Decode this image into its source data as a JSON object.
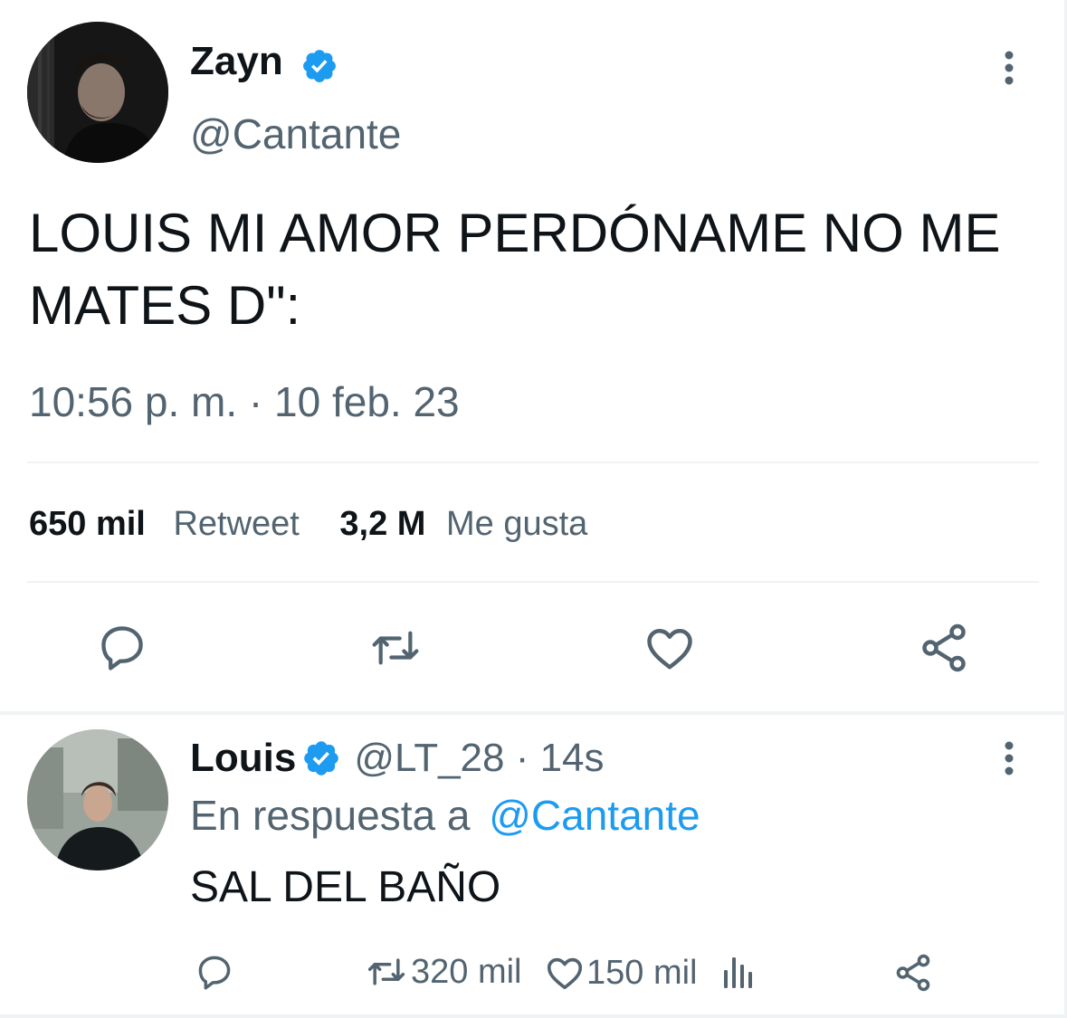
{
  "main_tweet": {
    "author_name": "Zayn",
    "handle": "@Cantante",
    "text_line1": "LOUIS MI AMOR PERDÓNAME NO ME",
    "text_line2": "MATES D\":",
    "timestamp": "10:56 p. m. · 10 feb. 23",
    "retweet_count": "650 mil",
    "retweet_label": "Retweet",
    "like_count": "3,2 M",
    "like_label": "Me gusta",
    "icons": [
      "reply-icon",
      "retweet-icon",
      "like-icon",
      "share-icon"
    ]
  },
  "reply": {
    "author_name": "Louis",
    "handle_time": "@LT_28 · 14s",
    "reply_prefix": "En respuesta a",
    "reply_to": "@Cantante",
    "text": "SAL DEL BAÑO",
    "retweet_count": "320 mil",
    "like_count": "150 mil"
  },
  "colors": {
    "accent": "#1d9bf0",
    "text": "#0f1419",
    "secondary": "#536471",
    "divider": "#eff3f4"
  }
}
